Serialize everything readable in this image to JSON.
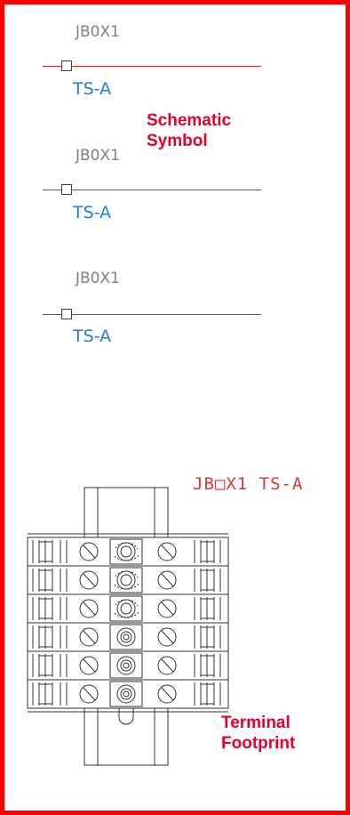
{
  "symbols": [
    {
      "device": "JB0X1",
      "terminal": "TS-A"
    },
    {
      "device": "JB0X1",
      "terminal": "TS-A"
    },
    {
      "device": "JB0X1",
      "terminal": "TS-A"
    }
  ],
  "callouts": {
    "schematic_line1": "Schematic",
    "schematic_line2": "Symbol",
    "footprint_line1": "Terminal",
    "footprint_line2": "Footprint"
  },
  "footprint_tag": "JB□X1 TS-A",
  "footprint": {
    "rows": 6,
    "rows_with_jumper": 3
  },
  "colors": {
    "frame": "#ff0000",
    "wire": "#e02424",
    "device_label": "#808080",
    "terminal_label": "#1e7fd0",
    "callout": "#e8002a",
    "drawing": "#303030"
  }
}
